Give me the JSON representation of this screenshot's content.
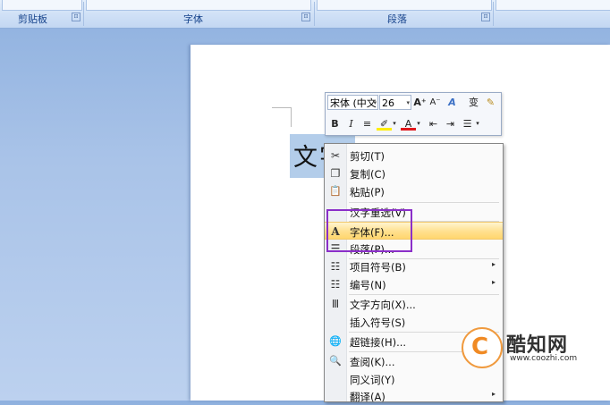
{
  "ribbon": {
    "groups": [
      {
        "label": "剪贴板"
      },
      {
        "label": "字体"
      },
      {
        "label": "段落"
      }
    ],
    "launcher_glyph": "⊡"
  },
  "document": {
    "text": "文字"
  },
  "mini_toolbar": {
    "font_name": "宋体 (中文",
    "font_size": "26",
    "grow_font": "A⁺",
    "shrink_font": "A⁻",
    "styles_glyph": "A",
    "phonetic_glyph": "变",
    "format_painter_glyph": "✎",
    "bold": "B",
    "italic": "I",
    "center_glyph": "≡",
    "highlight_glyph": "✐",
    "font_color_glyph": "A",
    "decrease_indent_glyph": "⇤",
    "increase_indent_glyph": "⇥",
    "bullets_glyph": "☰",
    "dropdown_glyph": "▾"
  },
  "context_menu": {
    "items": [
      {
        "label": "剪切(T)",
        "icon": "scissors-icon",
        "glyph": "✂"
      },
      {
        "label": "复制(C)",
        "icon": "copy-icon",
        "glyph": "❐"
      },
      {
        "label": "粘贴(P)",
        "icon": "paste-icon",
        "glyph": "📋"
      },
      {
        "label": "汉字重选(V)",
        "icon": "",
        "glyph": ""
      },
      {
        "label": "字体(F)...",
        "icon": "font-icon",
        "glyph": "A"
      },
      {
        "label": "段落(P)...",
        "icon": "paragraph-icon",
        "glyph": "☰"
      },
      {
        "label": "项目符号(B)",
        "icon": "bullets-icon",
        "glyph": "☷"
      },
      {
        "label": "编号(N)",
        "icon": "numbering-icon",
        "glyph": "☷"
      },
      {
        "label": "文字方向(X)...",
        "icon": "text-direction-icon",
        "glyph": "Ⅲ"
      },
      {
        "label": "插入符号(S)",
        "icon": "",
        "glyph": ""
      },
      {
        "label": "超链接(H)...",
        "icon": "hyperlink-icon",
        "glyph": "🌐"
      },
      {
        "label": "查阅(K)...",
        "icon": "research-icon",
        "glyph": "🔍"
      },
      {
        "label": "同义词(Y)",
        "icon": "",
        "glyph": ""
      },
      {
        "label": "翻译(A)",
        "icon": "",
        "glyph": ""
      }
    ],
    "submenu_arrow": "▸"
  },
  "watermark": {
    "logo_glyph": "C",
    "title": "酷知网",
    "url": "www.coozhi.com"
  },
  "colors": {
    "highlight": "#ffe08e",
    "annotation": "#8b2fc9",
    "selection": "#b3cdea"
  }
}
